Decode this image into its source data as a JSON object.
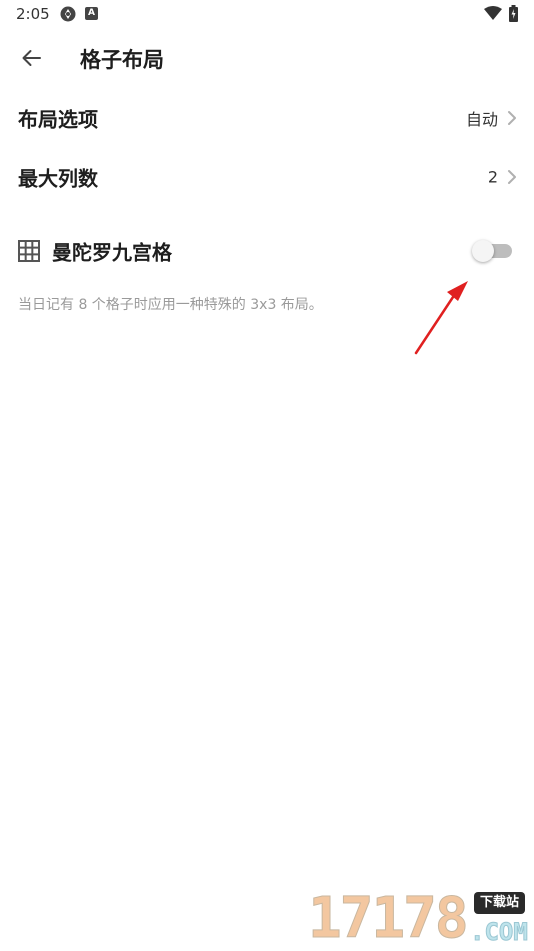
{
  "status_bar": {
    "time": "2:05",
    "app_icon_1": "camera-aperture-icon",
    "app_icon_2_letter": "A",
    "wifi_icon": "wifi-icon",
    "battery_icon": "battery-charging-icon"
  },
  "app_bar": {
    "back_icon": "arrow-left-icon",
    "title": "格子布局"
  },
  "settings": {
    "layout_option": {
      "label": "布局选项",
      "value": "自动"
    },
    "max_columns": {
      "label": "最大列数",
      "value": "2"
    },
    "mandala_grid": {
      "icon": "grid-3x3-icon",
      "label": "曼陀罗九宫格",
      "enabled": false,
      "description": "当日记有 8 个格子时应用一种特殊的 3x3 布局。"
    }
  },
  "annotation": {
    "color": "#e02020"
  },
  "watermark": {
    "digits": "17178",
    "badge": "下载站",
    "domain": ".COM"
  }
}
